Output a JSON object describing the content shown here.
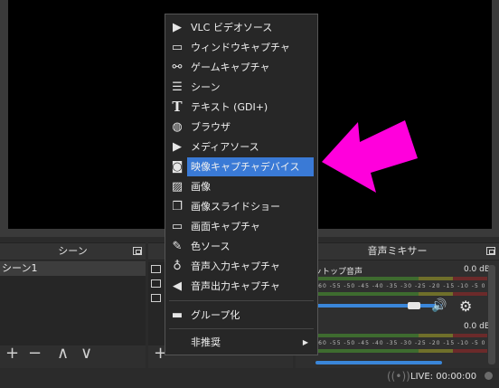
{
  "preview": {},
  "scenes_dock": {
    "title": "シーン",
    "items": [
      "シーン1"
    ],
    "toolbar": {
      "add": "+",
      "remove": "−",
      "up": "∧",
      "down": "∨"
    }
  },
  "sources_dock": {
    "toolbar": {
      "add": "+"
    }
  },
  "mixer_dock": {
    "title": "音声ミキサー",
    "channels": [
      {
        "label": "ットップ音声",
        "db": "0.0 dB"
      },
      {
        "label": "",
        "db": "0.0 dB"
      }
    ],
    "meter_ticks": "-60 -55 -50 -45 -40 -35 -30 -25 -20 -15 -10 -5 0"
  },
  "status": {
    "live": "LIVE: 00:00:00"
  },
  "context_menu": {
    "items": [
      {
        "icon": "play-icon",
        "label": "VLC ビデオソース"
      },
      {
        "icon": "window-icon",
        "label": "ウィンドウキャプチャ"
      },
      {
        "icon": "gamepad-icon",
        "label": "ゲームキャプチャ"
      },
      {
        "icon": "list-icon",
        "label": "シーン"
      },
      {
        "icon": "text-icon",
        "label": "テキスト (GDI+)"
      },
      {
        "icon": "globe-icon",
        "label": "ブラウザ"
      },
      {
        "icon": "play-icon",
        "label": "メディアソース"
      },
      {
        "icon": "camera-icon",
        "label": "映像キャプチャデバイス",
        "highlighted": true
      },
      {
        "icon": "image-icon",
        "label": "画像"
      },
      {
        "icon": "slideshow-icon",
        "label": "画像スライドショー"
      },
      {
        "icon": "monitor-icon",
        "label": "画面キャプチャ"
      },
      {
        "icon": "brush-icon",
        "label": "色ソース"
      },
      {
        "icon": "microphone-icon",
        "label": "音声入力キャプチャ"
      },
      {
        "icon": "speaker-icon",
        "label": "音声出力キャプチャ"
      }
    ],
    "group_label": "グループ化",
    "deprecated_label": "非推奨",
    "submenu_arrow": "▶"
  },
  "colors": {
    "highlight": "#3a7ad6",
    "annotation_arrow": "#ff00dc",
    "slider": "#3a86d9"
  }
}
